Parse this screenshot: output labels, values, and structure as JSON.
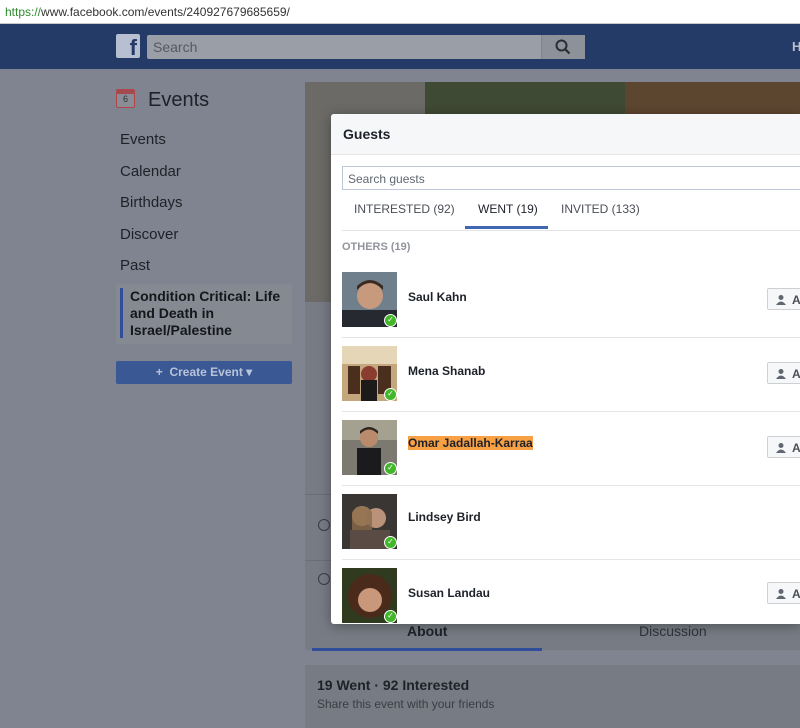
{
  "browser": {
    "url_proto": "https://",
    "url_rest": "www.facebook.com/events/240927679685659/"
  },
  "fb": {
    "logo": "f",
    "search_placeholder": "Search",
    "nav_partial": "H"
  },
  "sidebar": {
    "title": "Events",
    "calendar_day": "6",
    "items": [
      {
        "label": "Events"
      },
      {
        "label": "Calendar"
      },
      {
        "label": "Birthdays"
      },
      {
        "label": "Discover"
      },
      {
        "label": "Past"
      }
    ],
    "active_event": "Condition Critical: Life and Death in Israel/Palestine",
    "create_event": "Create Event"
  },
  "event_page": {
    "tab_about": "About",
    "tab_discussion": "Discussion",
    "stats": "19 Went · 92 Interested",
    "share_text": "Share this event with your friends"
  },
  "guests_modal": {
    "title": "Guests",
    "search_placeholder": "Search guests",
    "tabs": [
      {
        "label": "INTERESTED (92)"
      },
      {
        "label": "WENT (19)"
      },
      {
        "label": "INVITED (133)"
      }
    ],
    "section_label": "OTHERS (19)",
    "add_label": "A",
    "guests": [
      {
        "name": "Saul Kahn",
        "highlighted": false
      },
      {
        "name": "Mena Shanab",
        "highlighted": false
      },
      {
        "name": "Omar Jadallah-Karraa",
        "highlighted": true
      },
      {
        "name": "Lindsey Bird",
        "highlighted": false
      },
      {
        "name": "Susan Landau",
        "highlighted": false
      }
    ]
  },
  "colors": {
    "fb_blue": "#243a67",
    "accent": "#4267b2",
    "check_green": "#42b72a",
    "highlight": "#f8a044"
  }
}
